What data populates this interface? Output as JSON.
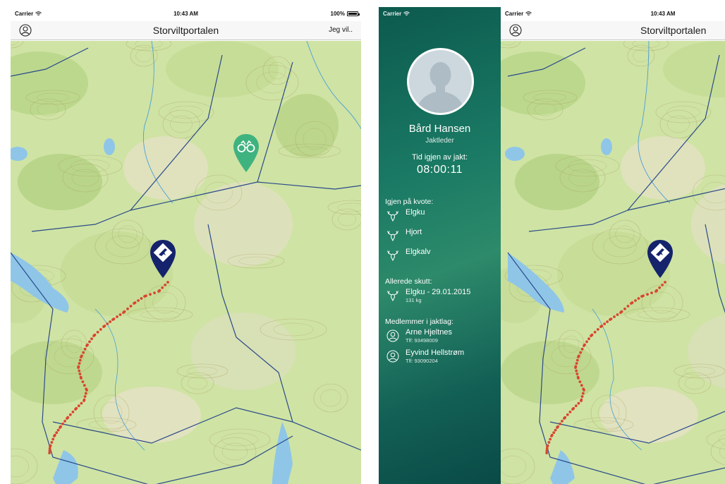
{
  "status": {
    "carrier": "Carrier",
    "time": "10:43 AM",
    "battery": "100%"
  },
  "nav": {
    "title": "Storviltportalen",
    "action": "Jeg vil.."
  },
  "sidebar": {
    "name": "Bård Hansen",
    "role": "Jaktleder",
    "time_label": "Tid igjen av jakt:",
    "time_value": "08:00:11",
    "quota_heading": "Igjen på kvote:",
    "quota": [
      "Elgku",
      "Hjort",
      "Elgkalv"
    ],
    "shot_heading": "Allerede skutt:",
    "shot": [
      {
        "label": "Elgku - 29.01.2015",
        "detail": "131 kg"
      }
    ],
    "members_heading": "Medlemmer i jaktlag:",
    "members": [
      {
        "name": "Arne Hjeltnes",
        "phone": "Tlf: 93498009"
      },
      {
        "name": "Eyvind Hellstrøm",
        "phone": "Tlf: 93090204"
      }
    ]
  },
  "colors": {
    "pin_navy": "#14236b",
    "pin_green": "#3fb37f",
    "track_red": "#d8452f",
    "boundary_blue": "#2a4a8a",
    "water": "#8fc6e8",
    "map_base": "#cfe3a4"
  },
  "icons": {
    "profile": "profile-circle-icon",
    "hunter_pin": "hunter-location-pin-icon",
    "binoculars_pin": "binoculars-pin-icon",
    "moose": "moose-head-icon"
  }
}
